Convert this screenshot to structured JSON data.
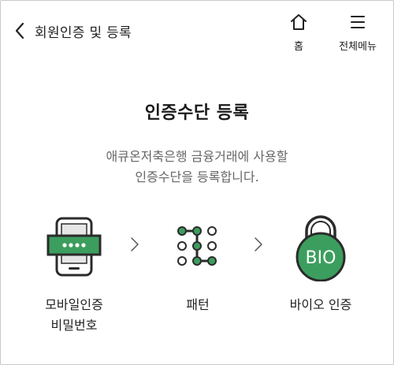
{
  "header": {
    "title": "회원인증 및 등록",
    "home_label": "홈",
    "menu_label": "전체메뉴"
  },
  "main": {
    "title": "인증수단 등록",
    "description": [
      "애큐온저축은행 금융거래에 사용할",
      "인증수단을 등록합니다."
    ],
    "methods": [
      {
        "icon": "mobile-phone-password-icon",
        "label_lines": [
          "모바일인증",
          "비밀번호"
        ]
      },
      {
        "icon": "pattern-grid-icon",
        "label_lines": [
          "패턴"
        ]
      },
      {
        "icon": "bio-lock-icon",
        "label_lines": [
          "바이오 인증"
        ],
        "icon_text": "BIO"
      }
    ]
  },
  "colors": {
    "accent_green": "#3c9e5e",
    "dark_outline": "#2b2b2b",
    "text_primary": "#222222",
    "text_secondary": "#666666"
  }
}
